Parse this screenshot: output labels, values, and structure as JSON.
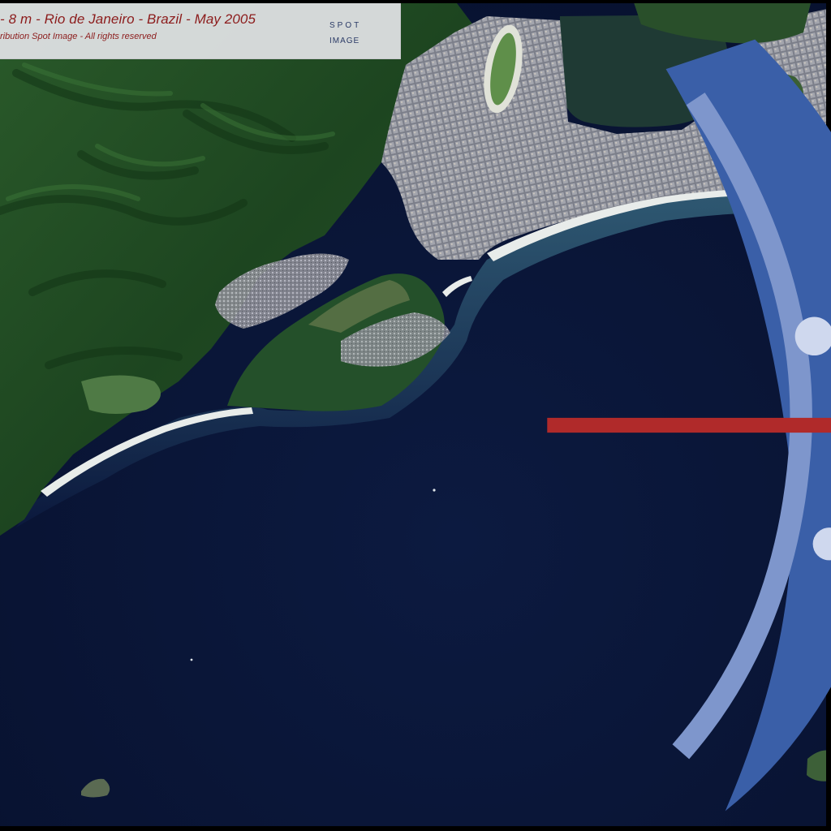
{
  "caption": {
    "title": "- 8 m - Rio de Janeiro - Brazil - May 2005",
    "credit": "ribution Spot Image - All rights reserved"
  },
  "logo": {
    "word_top": "SPOT",
    "word_bottom": "IMAGE"
  },
  "colors": {
    "caption_text": "#8c1c1c",
    "ocean": "#0a1535",
    "forest": "#1f4a22",
    "beach": "#e8ecea",
    "urban": "#8d8f98"
  },
  "icons": {
    "logo": "globe-icon"
  }
}
